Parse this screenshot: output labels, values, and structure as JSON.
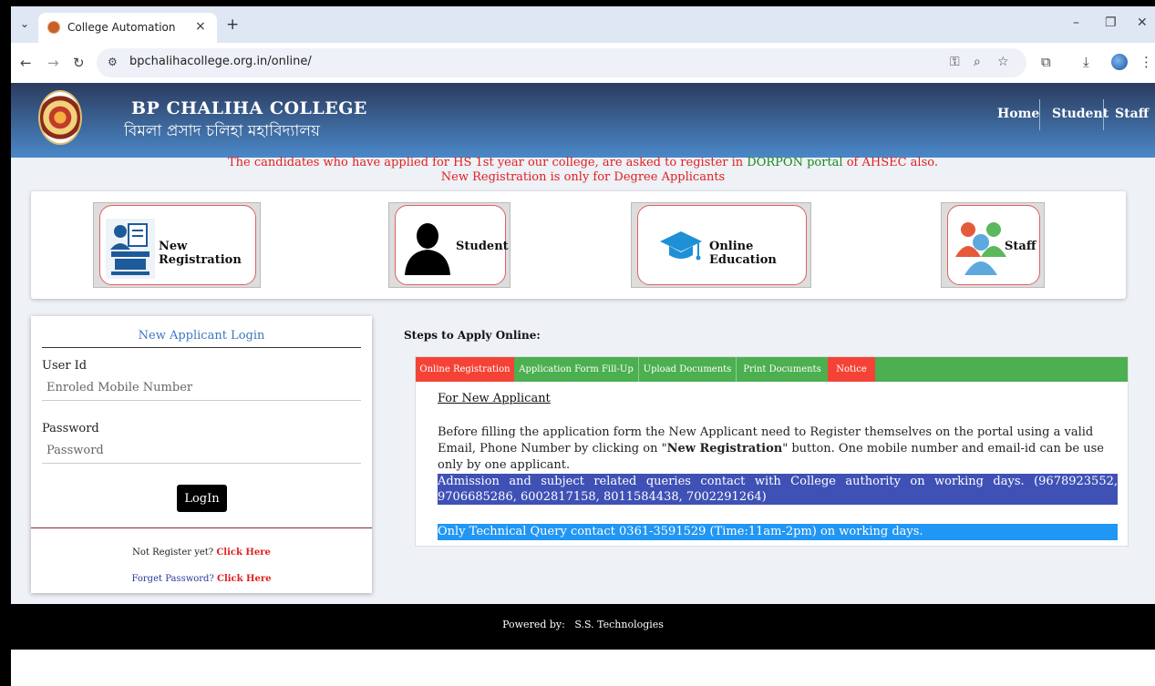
{
  "browser": {
    "tab_title": "College Automation",
    "tab_close": "×",
    "new_tab": "+",
    "dropdown": "⌄",
    "url": "bpchalihacollege.org.in/online/",
    "window_minimize": "–",
    "window_restore": "❐",
    "window_close": "✕"
  },
  "header": {
    "college_name": "BP CHALIHA COLLEGE",
    "college_name_local": "বিমলা প্ৰসাদ চলিহা মহাবিদ্যালয়",
    "nav": [
      "Home",
      "Student",
      "Staff"
    ]
  },
  "notice": {
    "line1_part1": "The candidates who have applied for HS 1st year our college, are asked to register in ",
    "line1_link": "DORPON portal",
    "line1_part2": " of AHSEC also.",
    "line2": "New Registration is only for Degree Applicants"
  },
  "cards": [
    {
      "label": "New Registration",
      "icon": "registration-icon"
    },
    {
      "label": "Student",
      "icon": "student-silhouette-icon"
    },
    {
      "label": "Online Education",
      "icon": "graduation-cap-icon"
    },
    {
      "label": "Staff",
      "icon": "staff-group-icon"
    }
  ],
  "login": {
    "title": "New Applicant Login",
    "userid_label": "User Id",
    "userid_placeholder": "Enroled Mobile Number",
    "password_label": "Password",
    "password_placeholder": "Password",
    "button": "LogIn",
    "register_prompt": "Not Register yet? ",
    "register_link": "Click Here",
    "forgot_prompt": "Forget Password? ",
    "forgot_link": "Click Here"
  },
  "steps": {
    "title": "Steps to Apply Online:",
    "tabs": [
      {
        "label": "Online Registration",
        "color": "#f44336"
      },
      {
        "label": "Application Form Fill-Up",
        "color": "#4caf50"
      },
      {
        "label": "Upload Documents",
        "color": "#4caf50"
      },
      {
        "label": "Print Documents",
        "color": "#4caf50"
      },
      {
        "label": "Notice",
        "color": "#f44336"
      }
    ],
    "heading": "For New Applicant",
    "para_part1": "Before filling the application form the New Applicant need to Register themselves on the portal using a valid Email, Phone Number by clicking on \"",
    "para_bold": "New Registration",
    "para_part2": "\" button. One mobile number and email-id can be use only by one applicant.",
    "highlight1": "Admission and subject related queries contact with College authority on working days. (9678923552, 9706685286, 6002817158, 8011584438, 7002291264)",
    "highlight2": "Only Technical Query contact 0361-3591529 (Time:11am-2pm) on working days."
  },
  "footer": {
    "label": "Powered by:",
    "company": "S.S. Technologies"
  },
  "colors": {
    "header_top": "#2b3b5e",
    "header_bottom": "#4a88c8",
    "notice_red": "#e02020",
    "tab_red": "#f44336",
    "tab_green": "#4caf50",
    "highlight_indigo": "#3f51b5",
    "highlight_blue": "#2196f3"
  }
}
